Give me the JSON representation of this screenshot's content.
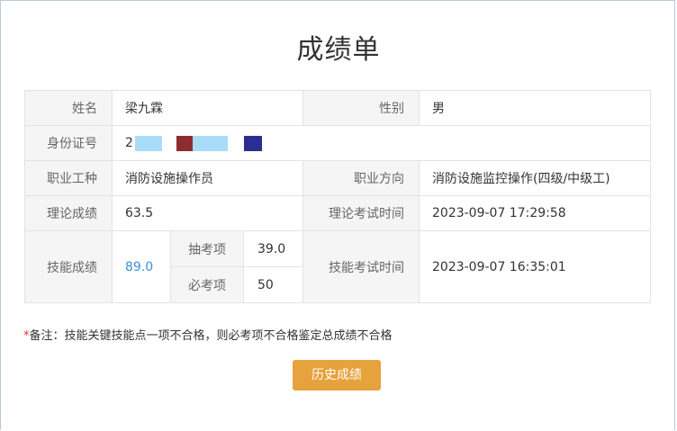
{
  "page": {
    "title": "成绩单"
  },
  "table": {
    "name_label": "姓名",
    "name_value": "梁九霖",
    "gender_label": "性别",
    "gender_value": "男",
    "id_label": "身份证号",
    "id_visible_prefix": "2",
    "occupation_label": "职业工种",
    "occupation_value": "消防设施操作员",
    "direction_label": "职业方向",
    "direction_value": "消防设施监控操作(四级/中级工)",
    "theory_label": "理论成绩",
    "theory_value": "63.5",
    "theory_time_label": "理论考试时间",
    "theory_time_value": "2023-09-07 17:29:58",
    "skill_label": "技能成绩",
    "skill_value": "89.0",
    "random_item_label": "抽考项",
    "random_item_value": "39.0",
    "required_item_label": "必考项",
    "required_item_value": "50",
    "skill_time_label": "技能考试时间",
    "skill_time_value": "2023-09-07 16:35:01"
  },
  "note": {
    "star": "*",
    "text": "备注：技能关键技能点一项不合格，则必考项不合格鉴定总成绩不合格"
  },
  "history_button": "历史成绩",
  "colors": {
    "accent_button": "#e6a23c",
    "skill_score": "#3d8fd8",
    "note_star": "#e0332d"
  }
}
